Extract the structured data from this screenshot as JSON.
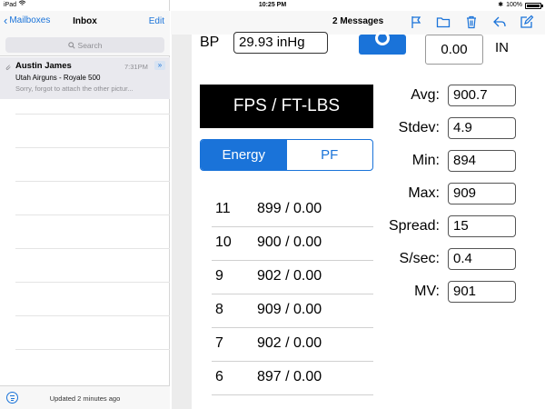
{
  "status_bar": {
    "device": "iPad",
    "time": "10:25 PM",
    "battery": "100%"
  },
  "mail_list": {
    "back_label": "Mailboxes",
    "title": "Inbox",
    "edit_label": "Edit",
    "search_placeholder": "Search",
    "messages": [
      {
        "sender": "Austin James",
        "time": "7:31PM",
        "subject": "Utah Airguns - Royale 500",
        "preview": "Sorry, forgot to attach the other pictur..."
      }
    ],
    "footer": "Updated 2 minutes ago"
  },
  "message_view": {
    "title": "2 Messages",
    "toolbar_icons": [
      "flag-icon",
      "folder-icon",
      "trash-icon",
      "reply-icon",
      "compose-icon"
    ]
  },
  "chrono": {
    "bp_label": "BP",
    "bp_value": "29.93 inHg",
    "in_value": "0.00",
    "in_label": "IN",
    "units_label": "FPS / FT-LBS",
    "tabs": [
      {
        "label": "Energy",
        "active": true
      },
      {
        "label": "PF",
        "active": false
      }
    ],
    "shots": [
      {
        "num": "11",
        "value": "899 / 0.00"
      },
      {
        "num": "10",
        "value": "900 / 0.00"
      },
      {
        "num": "9",
        "value": "902 / 0.00"
      },
      {
        "num": "8",
        "value": "909 / 0.00"
      },
      {
        "num": "7",
        "value": "902 / 0.00"
      },
      {
        "num": "6",
        "value": "897 / 0.00"
      }
    ],
    "stats": [
      {
        "label": "Avg:",
        "value": "900.7"
      },
      {
        "label": "Stdev:",
        "value": "4.9"
      },
      {
        "label": "Min:",
        "value": "894"
      },
      {
        "label": "Max:",
        "value": "909"
      },
      {
        "label": "Spread:",
        "value": "15"
      },
      {
        "label": "S/sec:",
        "value": "0.4"
      },
      {
        "label": "MV:",
        "value": "901"
      }
    ]
  },
  "colors": {
    "accent": "#1a73d9",
    "selected_row": "#e9e9ee"
  }
}
